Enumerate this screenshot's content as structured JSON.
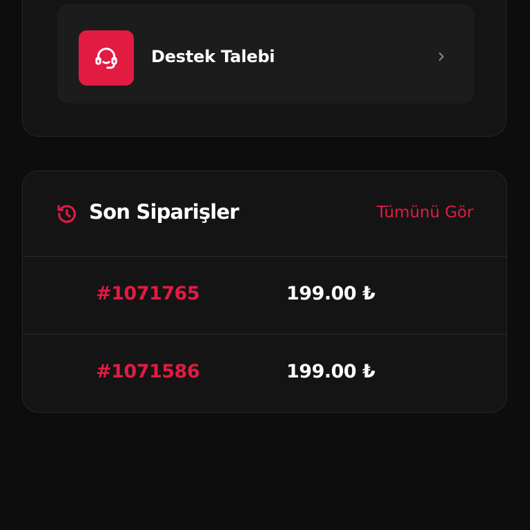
{
  "support": {
    "label": "Destek Talebi",
    "icon": "headset-icon",
    "chevron_icon": "chevron-right-icon"
  },
  "orders": {
    "title": "Son Siparişler",
    "title_icon": "history-icon",
    "view_all": "Tümünü Gör",
    "items": [
      {
        "id": "#1071765",
        "price": "199.00 ₺"
      },
      {
        "id": "#1071586",
        "price": "199.00 ₺"
      }
    ]
  },
  "colors": {
    "accent": "#e21b43",
    "background": "#0d0d0d",
    "card": "#141414",
    "row": "#1c1c1c"
  }
}
